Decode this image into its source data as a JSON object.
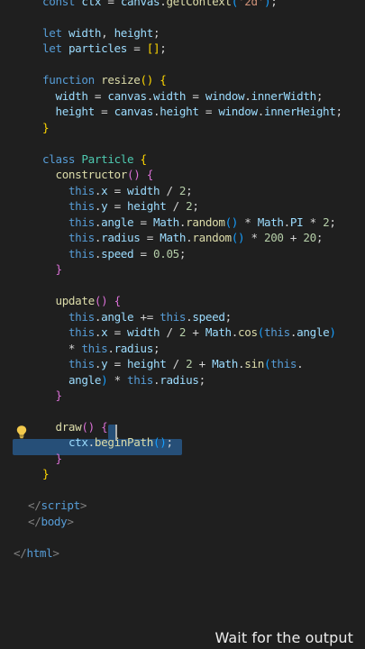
{
  "editor": {
    "lines": [
      [
        [
          "c-kw",
          "const "
        ],
        [
          "c-var",
          "ctx"
        ],
        [
          "c-op",
          " = "
        ],
        [
          "c-var",
          "canvas"
        ],
        [
          "c-op",
          "."
        ],
        [
          "c-fn",
          "getContext"
        ],
        [
          "c-brk3",
          "("
        ],
        [
          "c-str",
          "'2d'"
        ],
        [
          "c-brk3",
          ")"
        ],
        [
          "c-op",
          ";"
        ]
      ],
      [],
      [
        [
          "c-kw",
          "let "
        ],
        [
          "c-var",
          "width"
        ],
        [
          "c-op",
          ", "
        ],
        [
          "c-var",
          "height"
        ],
        [
          "c-op",
          ";"
        ]
      ],
      [
        [
          "c-kw",
          "let "
        ],
        [
          "c-var",
          "particles"
        ],
        [
          "c-op",
          " = "
        ],
        [
          "c-brk1",
          "[]"
        ],
        [
          "c-op",
          ";"
        ]
      ],
      [],
      [
        [
          "c-kw",
          "function "
        ],
        [
          "c-fn",
          "resize"
        ],
        [
          "c-brk1",
          "()"
        ],
        [
          "c-op",
          " "
        ],
        [
          "c-brk1",
          "{"
        ]
      ],
      [
        [
          "c-op",
          "  "
        ],
        [
          "c-var",
          "width"
        ],
        [
          "c-op",
          " = "
        ],
        [
          "c-var",
          "canvas"
        ],
        [
          "c-op",
          "."
        ],
        [
          "c-var",
          "width"
        ],
        [
          "c-op",
          " = "
        ],
        [
          "c-var",
          "window"
        ],
        [
          "c-op",
          "."
        ],
        [
          "c-var",
          "innerWidth"
        ],
        [
          "c-op",
          ";"
        ]
      ],
      [
        [
          "c-op",
          "  "
        ],
        [
          "c-var",
          "height"
        ],
        [
          "c-op",
          " = "
        ],
        [
          "c-var",
          "canvas"
        ],
        [
          "c-op",
          "."
        ],
        [
          "c-var",
          "height"
        ],
        [
          "c-op",
          " = "
        ],
        [
          "c-var",
          "window"
        ],
        [
          "c-op",
          "."
        ],
        [
          "c-var",
          "innerHeight"
        ],
        [
          "c-op",
          ";"
        ]
      ],
      [
        [
          "c-brk1",
          "}"
        ]
      ],
      [],
      [
        [
          "c-kw",
          "class "
        ],
        [
          "c-cls",
          "Particle"
        ],
        [
          "c-op",
          " "
        ],
        [
          "c-brk1",
          "{"
        ]
      ],
      [
        [
          "c-op",
          "  "
        ],
        [
          "c-fn",
          "constructor"
        ],
        [
          "c-brk2",
          "()"
        ],
        [
          "c-op",
          " "
        ],
        [
          "c-brk2",
          "{"
        ]
      ],
      [
        [
          "c-op",
          "    "
        ],
        [
          "c-this",
          "this"
        ],
        [
          "c-op",
          "."
        ],
        [
          "c-var",
          "x"
        ],
        [
          "c-op",
          " = "
        ],
        [
          "c-var",
          "width"
        ],
        [
          "c-op",
          " / "
        ],
        [
          "c-num",
          "2"
        ],
        [
          "c-op",
          ";"
        ]
      ],
      [
        [
          "c-op",
          "    "
        ],
        [
          "c-this",
          "this"
        ],
        [
          "c-op",
          "."
        ],
        [
          "c-var",
          "y"
        ],
        [
          "c-op",
          " = "
        ],
        [
          "c-var",
          "height"
        ],
        [
          "c-op",
          " / "
        ],
        [
          "c-num",
          "2"
        ],
        [
          "c-op",
          ";"
        ]
      ],
      [
        [
          "c-op",
          "    "
        ],
        [
          "c-this",
          "this"
        ],
        [
          "c-op",
          "."
        ],
        [
          "c-var",
          "angle"
        ],
        [
          "c-op",
          " = "
        ],
        [
          "c-var",
          "Math"
        ],
        [
          "c-op",
          "."
        ],
        [
          "c-fn",
          "random"
        ],
        [
          "c-brk3",
          "()"
        ],
        [
          "c-op",
          " * "
        ],
        [
          "c-var",
          "Math"
        ],
        [
          "c-op",
          "."
        ],
        [
          "c-var",
          "PI"
        ],
        [
          "c-op",
          " * "
        ],
        [
          "c-num",
          "2"
        ],
        [
          "c-op",
          ";"
        ]
      ],
      [
        [
          "c-op",
          "    "
        ],
        [
          "c-this",
          "this"
        ],
        [
          "c-op",
          "."
        ],
        [
          "c-var",
          "radius"
        ],
        [
          "c-op",
          " = "
        ],
        [
          "c-var",
          "Math"
        ],
        [
          "c-op",
          "."
        ],
        [
          "c-fn",
          "random"
        ],
        [
          "c-brk3",
          "()"
        ],
        [
          "c-op",
          " * "
        ],
        [
          "c-num",
          "200"
        ],
        [
          "c-op",
          " + "
        ],
        [
          "c-num",
          "20"
        ],
        [
          "c-op",
          ";"
        ]
      ],
      [
        [
          "c-op",
          "    "
        ],
        [
          "c-this",
          "this"
        ],
        [
          "c-op",
          "."
        ],
        [
          "c-var",
          "speed"
        ],
        [
          "c-op",
          " = "
        ],
        [
          "c-num",
          "0.05"
        ],
        [
          "c-op",
          ";"
        ]
      ],
      [
        [
          "c-op",
          "  "
        ],
        [
          "c-brk2",
          "}"
        ]
      ],
      [],
      [
        [
          "c-op",
          "  "
        ],
        [
          "c-fn",
          "update"
        ],
        [
          "c-brk2",
          "()"
        ],
        [
          "c-op",
          " "
        ],
        [
          "c-brk2",
          "{"
        ]
      ],
      [
        [
          "c-op",
          "    "
        ],
        [
          "c-this",
          "this"
        ],
        [
          "c-op",
          "."
        ],
        [
          "c-var",
          "angle"
        ],
        [
          "c-op",
          " += "
        ],
        [
          "c-this",
          "this"
        ],
        [
          "c-op",
          "."
        ],
        [
          "c-var",
          "speed"
        ],
        [
          "c-op",
          ";"
        ]
      ],
      [
        [
          "c-op",
          "    "
        ],
        [
          "c-this",
          "this"
        ],
        [
          "c-op",
          "."
        ],
        [
          "c-var",
          "x"
        ],
        [
          "c-op",
          " = "
        ],
        [
          "c-var",
          "width"
        ],
        [
          "c-op",
          " / "
        ],
        [
          "c-num",
          "2"
        ],
        [
          "c-op",
          " + "
        ],
        [
          "c-var",
          "Math"
        ],
        [
          "c-op",
          "."
        ],
        [
          "c-fn",
          "cos"
        ],
        [
          "c-brk3",
          "("
        ],
        [
          "c-this",
          "this"
        ],
        [
          "c-op",
          "."
        ],
        [
          "c-var",
          "angle"
        ],
        [
          "c-brk3",
          ")"
        ]
      ],
      [
        [
          "c-op",
          "    * "
        ],
        [
          "c-this",
          "this"
        ],
        [
          "c-op",
          "."
        ],
        [
          "c-var",
          "radius"
        ],
        [
          "c-op",
          ";"
        ]
      ],
      [
        [
          "c-op",
          "    "
        ],
        [
          "c-this",
          "this"
        ],
        [
          "c-op",
          "."
        ],
        [
          "c-var",
          "y"
        ],
        [
          "c-op",
          " = "
        ],
        [
          "c-var",
          "height"
        ],
        [
          "c-op",
          " / "
        ],
        [
          "c-num",
          "2"
        ],
        [
          "c-op",
          " + "
        ],
        [
          "c-var",
          "Math"
        ],
        [
          "c-op",
          "."
        ],
        [
          "c-fn",
          "sin"
        ],
        [
          "c-brk3",
          "("
        ],
        [
          "c-this",
          "this"
        ],
        [
          "c-op",
          "."
        ]
      ],
      [
        [
          "c-op",
          "    "
        ],
        [
          "c-var",
          "angle"
        ],
        [
          "c-brk3",
          ")"
        ],
        [
          "c-op",
          " * "
        ],
        [
          "c-this",
          "this"
        ],
        [
          "c-op",
          "."
        ],
        [
          "c-var",
          "radius"
        ],
        [
          "c-op",
          ";"
        ]
      ],
      [
        [
          "c-op",
          "  "
        ],
        [
          "c-brk2",
          "}"
        ]
      ],
      [],
      [
        [
          "c-op",
          "  "
        ],
        [
          "c-fn",
          "draw"
        ],
        [
          "c-brk2",
          "()"
        ],
        [
          "c-op",
          " "
        ],
        [
          "c-brk2",
          "{"
        ]
      ],
      [
        [
          "c-op",
          "    "
        ],
        [
          "c-var",
          "ctx"
        ],
        [
          "c-op",
          "."
        ],
        [
          "c-fn",
          "beginPath"
        ],
        [
          "c-brk3",
          "()"
        ],
        [
          "c-op",
          ";"
        ]
      ],
      [
        [
          "c-op",
          "  "
        ],
        [
          "c-brk2",
          "}"
        ]
      ],
      [
        [
          "c-brk1",
          "}"
        ]
      ],
      [],
      [
        [
          "c-tag",
          "</"
        ],
        [
          "c-kw",
          "script"
        ],
        [
          "c-tag",
          ">"
        ]
      ],
      [
        [
          "c-tag",
          "</"
        ],
        [
          "c-kw",
          "body"
        ],
        [
          "c-tag",
          ">"
        ]
      ],
      [],
      [
        [
          "c-tag",
          "</"
        ],
        [
          "c-kw",
          "html"
        ],
        [
          "c-tag",
          ">"
        ]
      ]
    ]
  },
  "caption": {
    "text": "Wait for the output"
  },
  "icons": {
    "lightbulb": "lightbulb-icon"
  },
  "colors": {
    "background": "#1f1f1f",
    "selection": "#264f78",
    "lightbulb": "#f2c94c"
  }
}
